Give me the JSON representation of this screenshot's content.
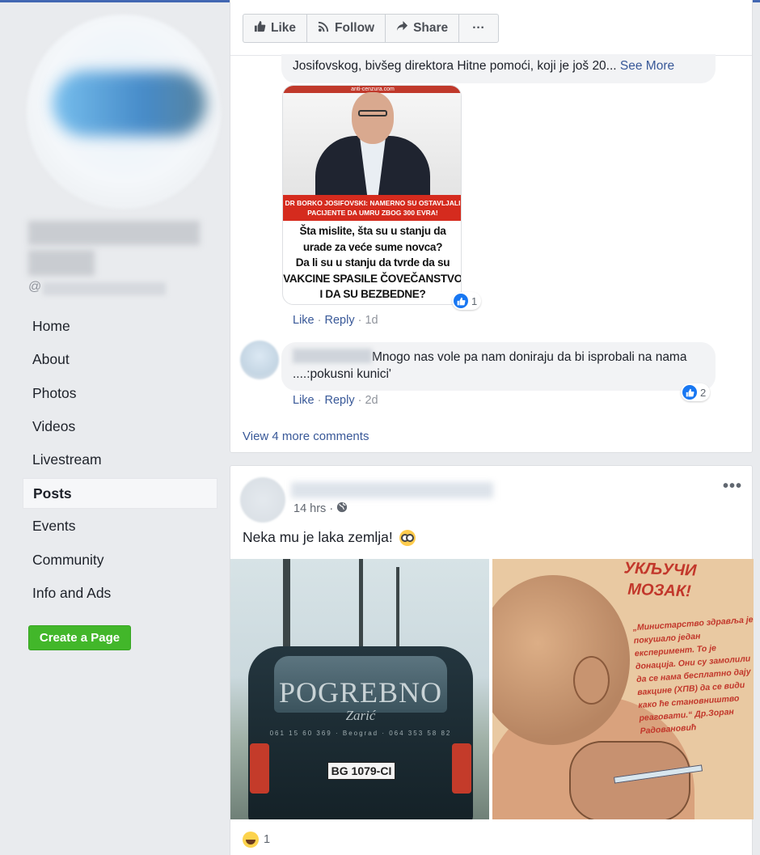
{
  "sidebar": {
    "handle_prefix": "@",
    "nav": [
      {
        "label": "Home"
      },
      {
        "label": "About"
      },
      {
        "label": "Photos"
      },
      {
        "label": "Videos"
      },
      {
        "label": "Livestream"
      },
      {
        "label": "Posts"
      },
      {
        "label": "Events"
      },
      {
        "label": "Community"
      },
      {
        "label": "Info and Ads"
      }
    ],
    "active_item": "Posts",
    "create_page_label": "Create a Page"
  },
  "page_actions": {
    "like": "Like",
    "follow": "Follow",
    "share": "Share",
    "more": "···"
  },
  "post1": {
    "comment1": {
      "text": "Josifovskog, bivšeg direktora Hitne pomoći, koji je još 20...",
      "see_more": "See More",
      "image": {
        "source_tag": "anti-cenzura.com",
        "headline_line1": "DR BORKO JOSIFOVSKI: NAMERNO SU OSTAVLJALI",
        "headline_line2": "PACIJENTE DA UMRU ZBOG 300 EVRA!",
        "body_lines": [
          "Šta mislite, šta su u stanju da",
          "urade za veće sume novca?",
          "Da li su u stanju da tvrde da su",
          "VAKCINE SPASILE ČOVEČANSTVO",
          "I DA SU BEZBEDNE?"
        ]
      },
      "reaction_count": "1",
      "like": "Like",
      "reply": "Reply",
      "time": "1d"
    },
    "comment2": {
      "text": "Mnogo nas vole pa nam doniraju da bi isprobali na nama ....:pokusni kunici'",
      "reaction_count": "2",
      "like": "Like",
      "reply": "Reply",
      "time": "2d"
    },
    "view_more": "View 4 more comments"
  },
  "post2": {
    "time": "14 hrs",
    "text": "Neka mu je laka zemlja!",
    "photo_left": {
      "brand": "POGREBNO",
      "sub": "Zarić",
      "phones": "061 15 60 369 · Beograd · 064 353 58 82",
      "plate": "BG 1079-CI"
    },
    "photo_right": {
      "title": "УКЉУЧИ МОЗАК!",
      "quote": "„Министарство здравља је покушало један експеримент. То је донација. Они су замолили да се нама бесплатно дају вакцине (ХПВ) да се види како ће становништво реаговати.“ Др.Зоран Радовановић"
    },
    "reaction_count": "1"
  },
  "colors": {
    "fb_blue": "#4267b2",
    "link": "#385898",
    "create_green": "#42b72a",
    "like_blue": "#1877f2"
  }
}
